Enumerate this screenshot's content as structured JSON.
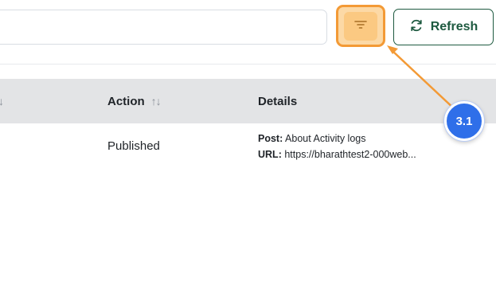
{
  "toolbar": {
    "search": {
      "value": "",
      "placeholder": ""
    },
    "filter_icon": "filter-icon",
    "refresh": {
      "label": "Refresh",
      "icon": "refresh-icon"
    }
  },
  "table": {
    "columns": [
      {
        "label": "",
        "sort_icon": "↓"
      },
      {
        "label": "Action",
        "sort_icon": "↑↓"
      },
      {
        "label": "Details",
        "sort_icon": ""
      }
    ],
    "rows": [
      {
        "action": "Published",
        "details": {
          "post_label": "Post:",
          "post_value": "About Activity logs",
          "url_label": "URL:",
          "url_value": "https://bharathtest2-000web..."
        }
      }
    ]
  },
  "annotation": {
    "label": "3.1",
    "color": "#2f6fe9",
    "arrow_color": "#f39a36"
  },
  "colors": {
    "accent": "#1e5a40",
    "highlight": "#f39a36",
    "header_bg": "#e3e4e6"
  }
}
